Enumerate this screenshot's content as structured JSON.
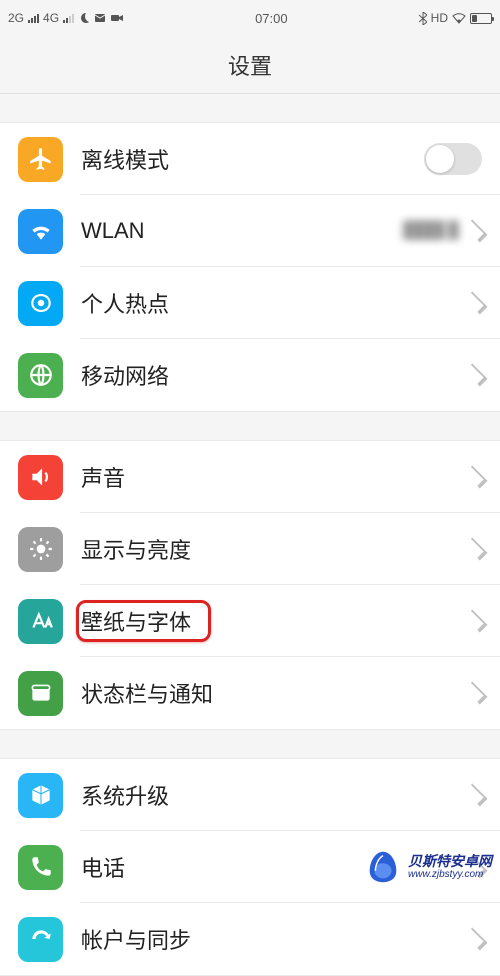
{
  "status": {
    "net1": "2G",
    "net2": "4G",
    "time": "07:00",
    "hd": "HD"
  },
  "title": "设置",
  "g1": [
    {
      "icon": "plane",
      "label": "离线模式",
      "type": "toggle"
    },
    {
      "icon": "wifi",
      "label": "WLAN",
      "type": "value",
      "value": "████ █"
    },
    {
      "icon": "hot",
      "label": "个人热点",
      "type": "nav"
    },
    {
      "icon": "net",
      "label": "移动网络",
      "type": "nav"
    }
  ],
  "g2": [
    {
      "icon": "snd",
      "label": "声音",
      "type": "nav"
    },
    {
      "icon": "disp",
      "label": "显示与亮度",
      "type": "nav"
    },
    {
      "icon": "wall",
      "label": "壁纸与字体",
      "type": "nav",
      "highlight": true
    },
    {
      "icon": "stat",
      "label": "状态栏与通知",
      "type": "nav"
    }
  ],
  "g3": [
    {
      "icon": "upd",
      "label": "系统升级",
      "type": "nav"
    },
    {
      "icon": "phone",
      "label": "电话",
      "type": "nav"
    },
    {
      "icon": "acc",
      "label": "帐户与同步",
      "type": "nav"
    }
  ],
  "wm": {
    "name": "贝斯特安卓网",
    "url": "www.zjbstyy.com"
  }
}
